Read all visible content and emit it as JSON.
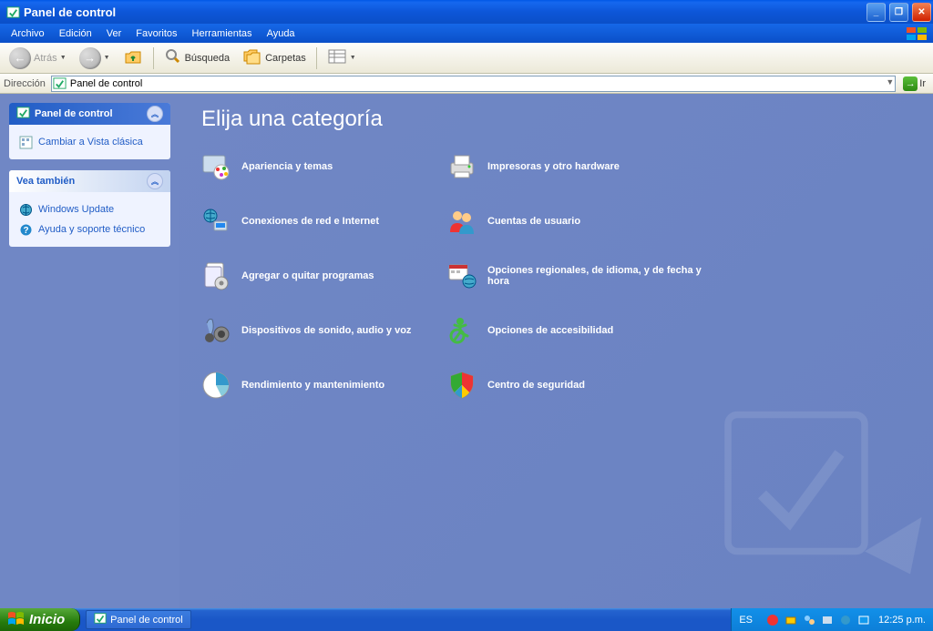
{
  "window": {
    "title": "Panel de control"
  },
  "menubar": [
    "Archivo",
    "Edición",
    "Ver",
    "Favoritos",
    "Herramientas",
    "Ayuda"
  ],
  "toolbar": {
    "back": "Atrás",
    "search": "Búsqueda",
    "folders": "Carpetas"
  },
  "addressbar": {
    "label": "Dirección",
    "value": "Panel de control",
    "go": "Ir"
  },
  "sidebar": {
    "panel1": {
      "title": "Panel de control",
      "link": "Cambiar a Vista clásica"
    },
    "panel2": {
      "title": "Vea también",
      "links": [
        "Windows Update",
        "Ayuda y soporte técnico"
      ]
    }
  },
  "main": {
    "heading": "Elija una categoría",
    "categories": [
      {
        "id": "appearance",
        "label": "Apariencia y temas"
      },
      {
        "id": "printers",
        "label": "Impresoras y otro hardware"
      },
      {
        "id": "network",
        "label": "Conexiones de red e Internet"
      },
      {
        "id": "users",
        "label": "Cuentas de usuario"
      },
      {
        "id": "addremove",
        "label": "Agregar o quitar programas"
      },
      {
        "id": "regional",
        "label": "Opciones regionales, de idioma, y de fecha y hora"
      },
      {
        "id": "sound",
        "label": "Dispositivos de sonido, audio y voz"
      },
      {
        "id": "accessibility",
        "label": "Opciones de accesibilidad"
      },
      {
        "id": "performance",
        "label": "Rendimiento y mantenimiento"
      },
      {
        "id": "security",
        "label": "Centro de seguridad"
      }
    ]
  },
  "taskbar": {
    "start": "Inicio",
    "item": "Panel de control",
    "lang": "ES",
    "clock": "12:25 p.m."
  }
}
